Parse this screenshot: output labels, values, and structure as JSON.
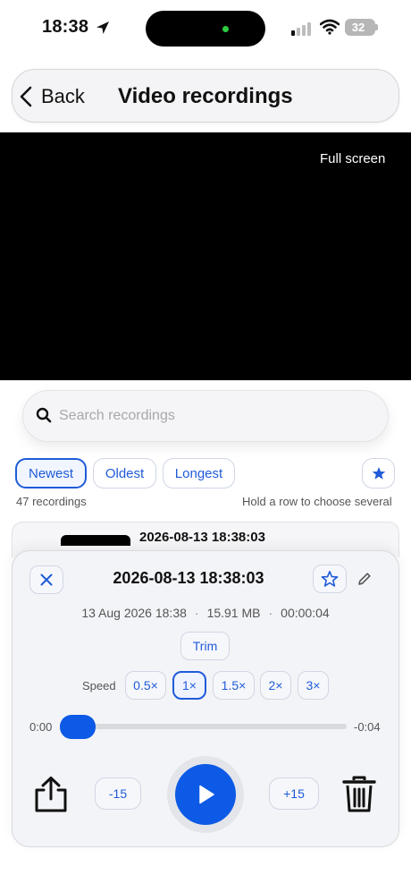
{
  "status_bar": {
    "time": "18:38",
    "battery": "32"
  },
  "header": {
    "back_label": "Back",
    "title": "Video recordings"
  },
  "video": {
    "fullscreen_label": "Full screen"
  },
  "search": {
    "placeholder": "Search recordings"
  },
  "filters": {
    "newest": "Newest",
    "oldest": "Oldest",
    "longest": "Longest",
    "active": "Newest"
  },
  "list_meta": {
    "count": "47 recordings",
    "hint": "Hold a row to choose several"
  },
  "list": {
    "first_row_title": "2026-08-13 18:38:03"
  },
  "player": {
    "title": "2026-08-13 18:38:03",
    "date": "13 Aug 2026 18:38",
    "size": "15.91 MB",
    "duration": "00:00:04",
    "trim_label": "Trim",
    "speed_label": "Speed",
    "speeds": [
      "0.5×",
      "1×",
      "1.5×",
      "2×",
      "3×"
    ],
    "active_speed": "1×",
    "elapsed": "0:00",
    "remaining": "-0:04",
    "progress": 0,
    "skip_back": "-15",
    "skip_forward": "+15"
  },
  "colors": {
    "accent": "#0d5ae6",
    "chip_text": "#1f5bd8",
    "video_bg": "#000000"
  }
}
